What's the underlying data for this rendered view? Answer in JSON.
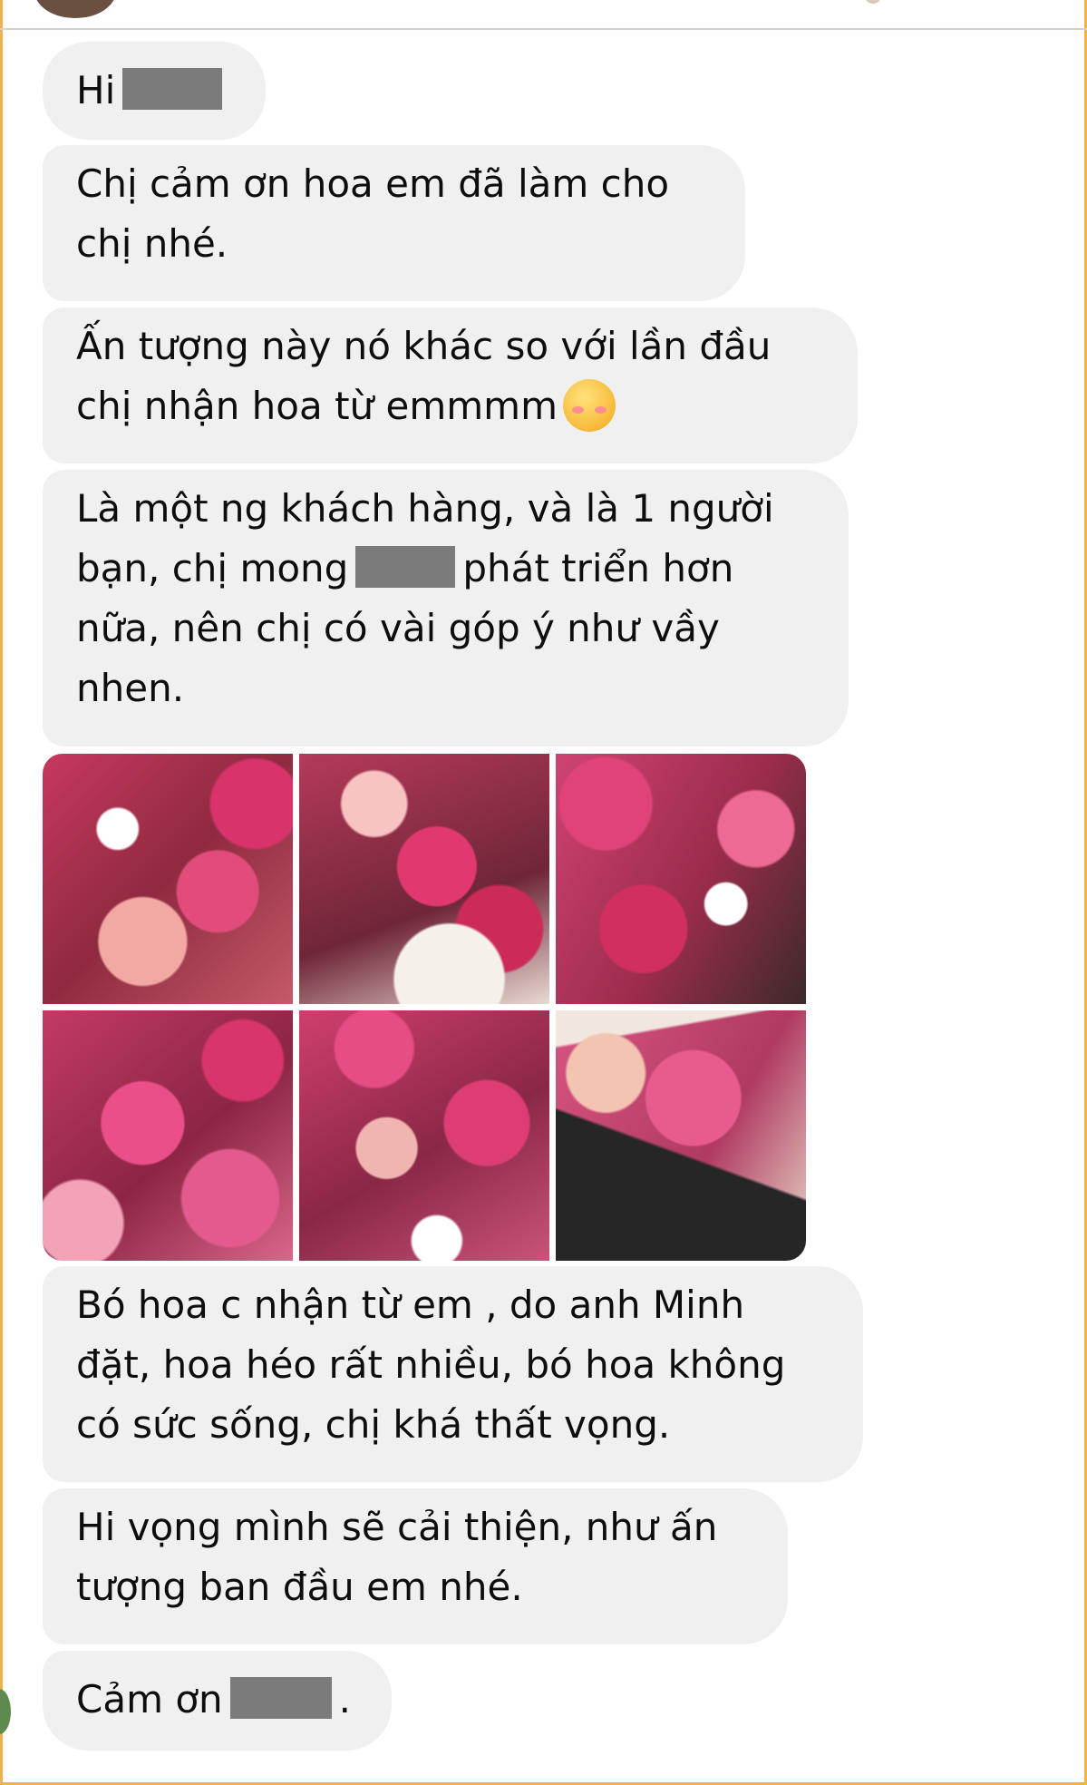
{
  "conversation": {
    "messages": [
      {
        "id": "m1",
        "text_before": "Hi",
        "redacted": true,
        "text_after": ""
      },
      {
        "id": "m2",
        "lines": [
          "Chị cảm ơn hoa em đã làm cho",
          "chị nhé."
        ]
      },
      {
        "id": "m3",
        "lines": [
          "Ấn tượng này nó khác so với lần đầu",
          "chị nhận hoa từ emmmm"
        ],
        "emoji": "smiling-face-with-hearts"
      },
      {
        "id": "m4",
        "line1": "Là một ng khách hàng, và là 1 người",
        "line2_before": "bạn, chị mong",
        "line2_after": "phát triển hơn",
        "line3": "nữa, nên chị có vài góp ý như vầy",
        "line4": "nhen."
      },
      {
        "id": "m5",
        "lines": [
          "Bó hoa c nhận từ em , do anh Minh",
          "đặt, hoa héo rất nhiều, bó hoa không",
          "có sức sống, chị khá thất vọng."
        ]
      },
      {
        "id": "m6",
        "lines": [
          "Hi vọng mình sẽ cải thiện, như ấn",
          "tượng ban đầu em nhé."
        ]
      },
      {
        "id": "m7",
        "text_before": "Cảm ơn",
        "text_after": "."
      }
    ],
    "photo_grid": {
      "photos": [
        {
          "name": "rose-bouquet-photo-1"
        },
        {
          "name": "rose-bouquet-photo-2"
        },
        {
          "name": "rose-bouquet-photo-3"
        },
        {
          "name": "rose-bouquet-photo-4"
        },
        {
          "name": "rose-bouquet-photo-5"
        },
        {
          "name": "rose-bouquet-photo-6"
        }
      ]
    }
  },
  "colors": {
    "bubble_bg": "#f0f0f0",
    "frame": "#f0b24a",
    "text": "#0d0d0d",
    "redaction": "#7b7b7b"
  }
}
